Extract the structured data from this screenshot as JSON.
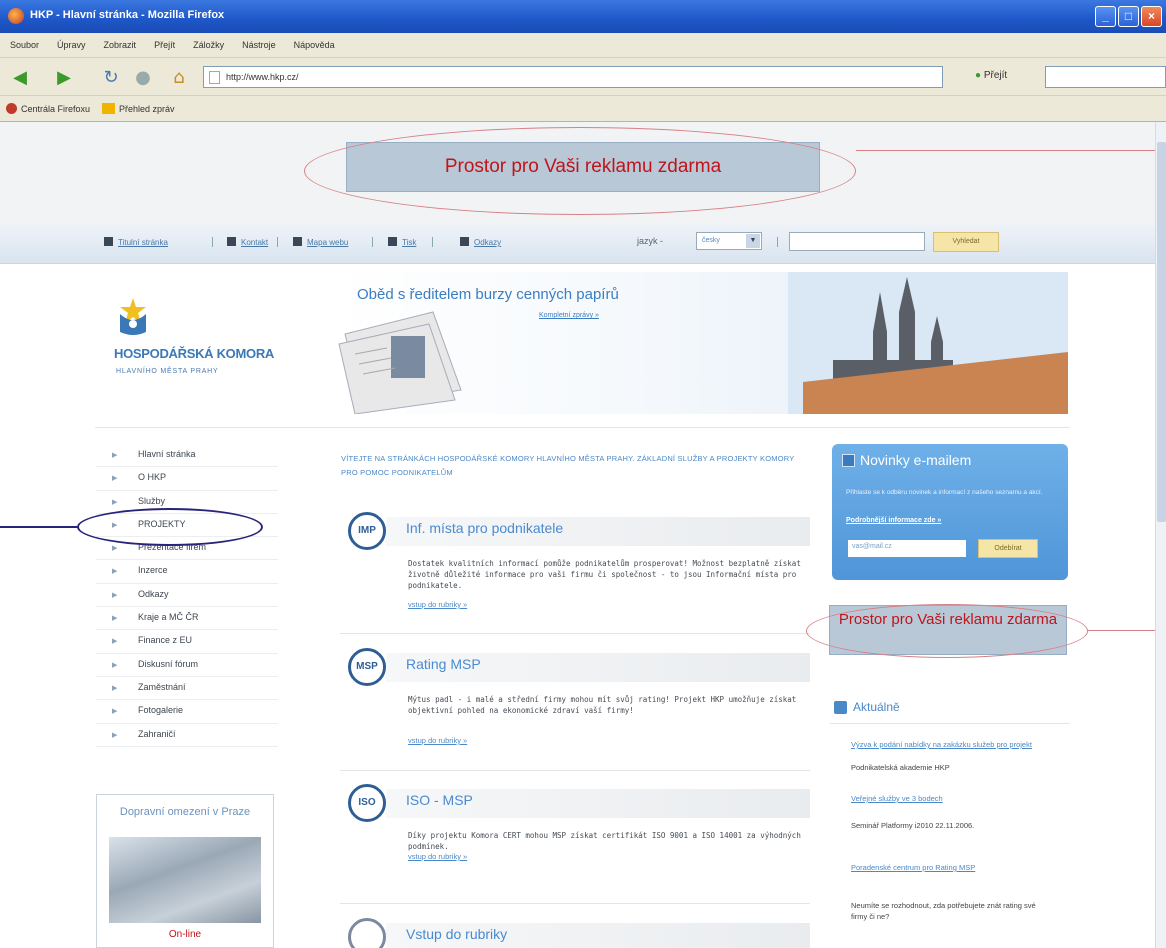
{
  "window": {
    "title": "HKP - Hlavní stránka - Mozilla Firefox",
    "buttons": [
      "_",
      "□",
      "×"
    ]
  },
  "menu": [
    "Soubor",
    "Úpravy",
    "Zobrazit",
    "Přejít",
    "Záložky",
    "Nástroje",
    "Nápověda"
  ],
  "navbar": {
    "url": "http://www.hkp.cz/",
    "go_label": "Přejít",
    "icons": [
      "back-icon",
      "forward-icon",
      "reload-icon",
      "stop-icon",
      "home-icon"
    ]
  },
  "bookmarks": [
    "Centrála Firefoxu",
    "Přehled zpráv"
  ],
  "ads": {
    "top": "Prostor pro Vaši reklamu zdarma",
    "right": "Prostor pro Vaši reklamu zdarma",
    "color": "#c0141b"
  },
  "toolstrip": {
    "links": [
      "Titulní stránka",
      "Kontakt",
      "Mapa webu",
      "Tisk",
      "Odkazy"
    ],
    "language_label": "jazyk -",
    "language_value": "česky",
    "search_button": "Vyhledat"
  },
  "logo": {
    "name": "HOSPODÁŘSKÁ KOMORA",
    "sub": "HLAVNÍHO MĚSTA PRAHY"
  },
  "banner": {
    "title": "Oběd s ředitelem burzy cenných papírů",
    "link": "Kompletní zprávy »"
  },
  "sidebar": {
    "items": [
      {
        "label": "Hlavní stránka"
      },
      {
        "label": "O HKP"
      },
      {
        "label": "Služby"
      },
      {
        "label": "PROJEKTY"
      },
      {
        "label": "Prezentace firem"
      },
      {
        "label": "Inzerce"
      },
      {
        "label": "Odkazy"
      },
      {
        "label": "Kraje a MČ ČR"
      },
      {
        "label": "Finance z EU"
      },
      {
        "label": "Diskusní fórum"
      },
      {
        "label": "Zaměstnání"
      },
      {
        "label": "Fotogalerie"
      },
      {
        "label": "Zahraničí"
      }
    ]
  },
  "traffic": {
    "title": "Dopravní omezení v Praze",
    "online": "On-line"
  },
  "intro": "VÍTEJTE NA STRÁNKÁCH HOSPODÁŘSKÉ KOMORY HLAVNÍHO MĚSTA PRAHY. ZÁKLADNÍ SLUŽBY A PROJEKTY KOMORY PRO POMOC PODNIKATELŮM",
  "sections": [
    {
      "icon": "IMP",
      "title": "Inf. místa pro podnikatele",
      "body": "Dostatek kvalitních informací pomůže podnikatelům prosperovat! Možnost bezplatně získat životně důležité informace pro vaši firmu či společnost - to jsou Informační místa pro podnikatele.",
      "more": "vstup do rubriky »"
    },
    {
      "icon": "MSP",
      "title": "Rating MSP",
      "body": "Mýtus padl - i malé a střední firmy mohou mít svůj rating! Projekt HKP umožňuje získat objektivní pohled na ekonomické zdraví vaší firmy!",
      "more": "vstup do rubriky »"
    },
    {
      "icon": "ISO",
      "title": "ISO - MSP",
      "body": "Díky projektu Komora CERT mohou MSP získat certifikát ISO 9001 a ISO 14001 za výhodných podmínek.",
      "more": "vstup do rubriky »"
    },
    {
      "icon": "",
      "title": "Vstup do rubriky",
      "body": "",
      "more": ""
    }
  ],
  "newsletter": {
    "title": "Novinky e-mailem",
    "text": "Přihlaste se k odběru novinek a informací z našeho seznamu a akcí.",
    "link": "Podrobnější informace zde »",
    "input_value": "vas@mail.cz",
    "button": "Odebírat"
  },
  "aktualne": {
    "title": "Aktuálně",
    "items": [
      {
        "text": "Výzva k podání nabídky na zakázku služeb pro projekt",
        "link": true
      },
      {
        "text": "Podnikatelská akademie HKP",
        "link": false
      },
      {
        "text": "Veřejné služby ve 3 bodech",
        "link": true
      },
      {
        "text": "Seminář Platformy i2010 22.11.2006.",
        "link": false
      },
      {
        "text": "Poradenské centrum pro Rating MSP",
        "link": true
      },
      {
        "text": "Neumíte se rozhodnout, zda potřebujete znát rating své firmy či ne?",
        "link": false
      }
    ]
  }
}
